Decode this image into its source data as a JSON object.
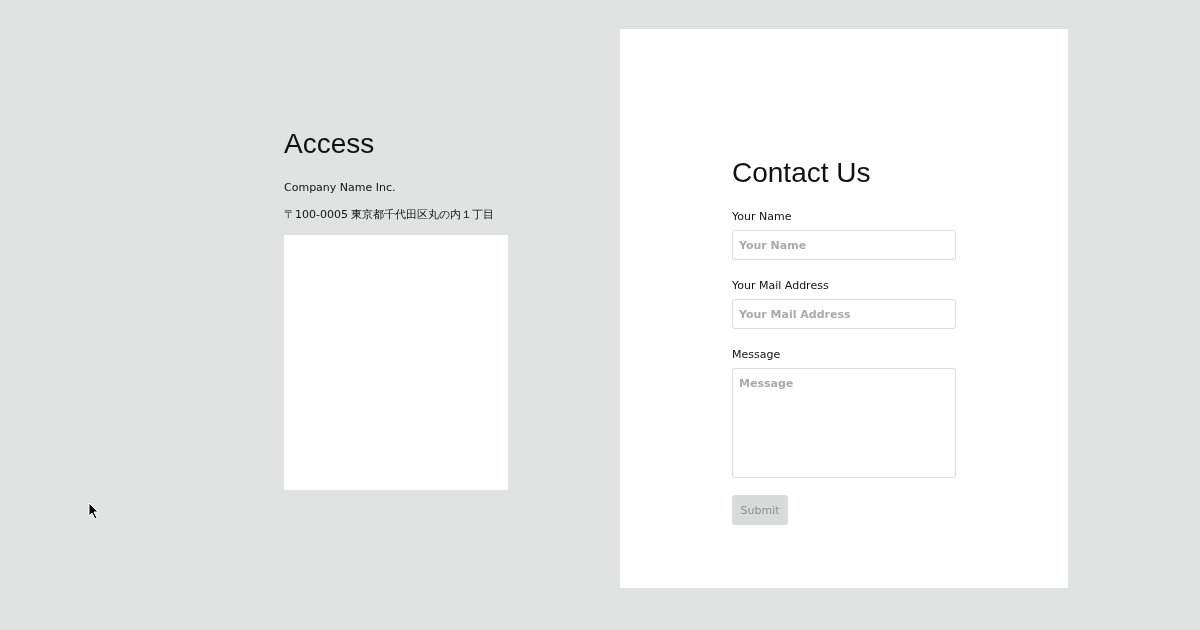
{
  "access": {
    "title": "Access",
    "company": "Company Name Inc.",
    "address": "〒100-0005 東京都千代田区丸の内１丁目"
  },
  "contact": {
    "title": "Contact Us",
    "fields": [
      {
        "kind": "input",
        "label": "Your Name",
        "placeholder": "Your Name"
      },
      {
        "kind": "input",
        "label": "Your Mail Address",
        "placeholder": "Your Mail Address"
      },
      {
        "kind": "textarea",
        "label": "Message",
        "placeholder": "Message"
      }
    ],
    "submit": {
      "label": "Submit",
      "disabled": true
    }
  }
}
